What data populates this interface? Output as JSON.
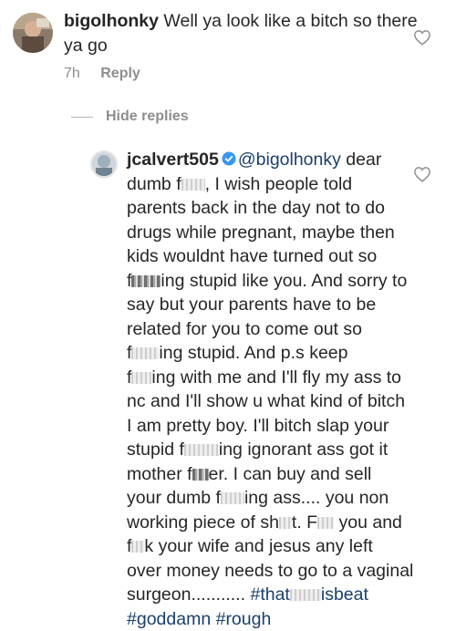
{
  "comment_1": {
    "username": "bigolhonky",
    "text": "Well ya look like a bitch so there ya go",
    "time": "7h",
    "reply_label": "Reply",
    "avatar_icon": "profile-photo",
    "like_icon": "heart-outline-icon"
  },
  "hide_replies": {
    "label": "Hide replies"
  },
  "comment_2": {
    "username": "jcalvert505",
    "verified_icon": "verified-badge-icon",
    "avatar_icon": "profile-photo",
    "like_icon": "heart-outline-icon",
    "mention": "@bigolhonky",
    "lines": [
      " dear",
      "dumb f",
      ", I wish people told",
      "parents back in the day not to do",
      "drugs while pregnant, maybe then",
      "kids wouldnt have turned out so",
      "f",
      "ing stupid like you. And sorry to",
      "say but your parents have to be",
      "related for you to come out so",
      "f",
      "ing stupid. And p.s keep",
      "f",
      "ing with me and I'll fly my ass to",
      "nc and I'll show u what kind of bitch",
      "I am pretty boy. I'll bitch slap your",
      "stupid f",
      "ing ignorant ass got it",
      "mother f",
      "er. I can buy and sell",
      "your dumb f",
      "ing ass.... you non",
      "working piece of sh",
      "t. F",
      " you and",
      "f",
      "k your wife and jesus any left",
      "over money needs to go to a vaginal",
      "surgeon........... ",
      "#that",
      "isbeat",
      "#goddamn",
      " ",
      "#rough"
    ]
  },
  "colors": {
    "text": "#262626",
    "meta": "#8e8e8e",
    "link": "#1a3f6b",
    "verified": "#3897f0"
  }
}
